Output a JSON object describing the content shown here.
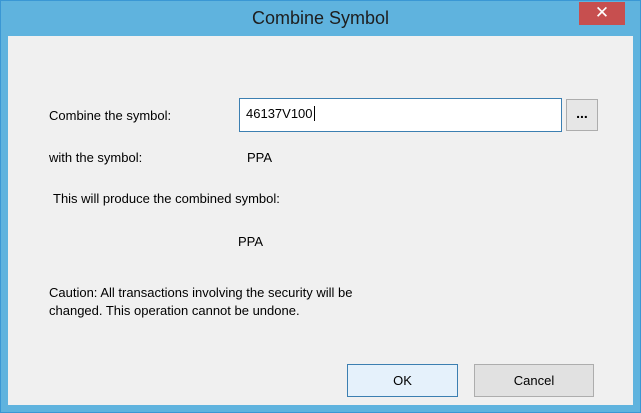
{
  "window": {
    "title": "Combine Symbol",
    "close_glyph": "✕"
  },
  "form": {
    "combine_label": "Combine the symbol:",
    "combine_value": "46137V100",
    "browse_label": "...",
    "with_label": "with the symbol:",
    "with_value": "PPA",
    "produce_label": "This will produce the combined symbol:",
    "combined_value": "PPA",
    "caution_line1": "Caution:  All transactions involving the security will be",
    "caution_line2": "changed.  This operation cannot be undone."
  },
  "buttons": {
    "ok_label": "OK",
    "cancel_label": "Cancel"
  },
  "colors": {
    "titlebar": "#5fb3de",
    "close_button": "#c74f4f",
    "client_background": "#f0f0f0"
  }
}
